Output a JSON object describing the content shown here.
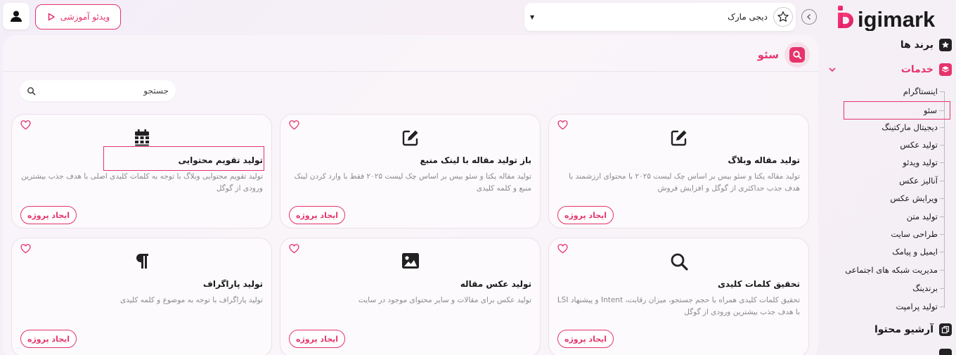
{
  "app": {
    "logo_text": "Digimark",
    "brand_selector": "دیجی مارک",
    "video_tutorial": "ویدئو آموزشی"
  },
  "section": {
    "title": "سئو",
    "search_placeholder": "جستجو"
  },
  "cards": [
    {
      "title": "تولید مقاله وبلاگ",
      "desc": "تولید مقاله یکتا و سئو بیس بر اساس چک لیست ۲۰۲۵ با محتوای ارزشمند با هدف جذب حداکثری از گوگل و افزایش فروش",
      "button": "ایجاد پروژه",
      "icon": "edit-icon"
    },
    {
      "title": "باز تولید مقاله با لینک منبع",
      "desc": "تولید مقاله یکتا و سئو بیس بر اساس چک لیست ۲۰۲۵ فقط با وارد کردن لینک منبع و کلمه کلیدی",
      "button": "ایجاد پروژه",
      "icon": "edit-icon"
    },
    {
      "title": "تولید تقویم محتوایی",
      "desc": "تولید تقویم محتوایی وبلاگ با توجه به کلمات کلیدی اصلی با هدف جذب بیشترین ورودی از گوگل",
      "button": "ایجاد پروژه",
      "icon": "calendar-icon"
    },
    {
      "title": "تحقیق کلمات کلیدی",
      "desc": "تحقیق کلمات کلیدی همراه با حجم جستجو، میزان رقابت، Intent و پیشنهاد LSI با هدف جذب بیشترین ورودی از گوگل",
      "button": "ایجاد پروژه",
      "icon": "search-icon"
    },
    {
      "title": "تولید عکس مقاله",
      "desc": "تولید عکس برای مقالات و سایر محتوای موجود در سایت",
      "button": "ایجاد پروژه",
      "icon": "image-icon"
    },
    {
      "title": "تولید پاراگراف",
      "desc": "تولید پاراگراف با توجه به موضوع و کلمه کلیدی",
      "button": "ایجاد پروژه",
      "icon": "paragraph-icon"
    }
  ],
  "sidebar": {
    "brands": "برند ها",
    "services": "خدمات",
    "archive": "آرشیو محتوا",
    "sub_items": [
      "اینستاگرام",
      "سئو",
      "دیجیتال مارکتینگ",
      "تولید عکس",
      "تولید ویدئو",
      "آنالیز عکس",
      "ویرایش عکس",
      "تولید متن",
      "طراحی سایت",
      "ایمیل و پیامک",
      "مدیریت شبکه های اجتماعی",
      "برندینگ",
      "تولید پرامپت"
    ]
  },
  "colors": {
    "accent": "#e6336b",
    "text": "#1a1a1a",
    "muted": "#8a8a8a"
  }
}
